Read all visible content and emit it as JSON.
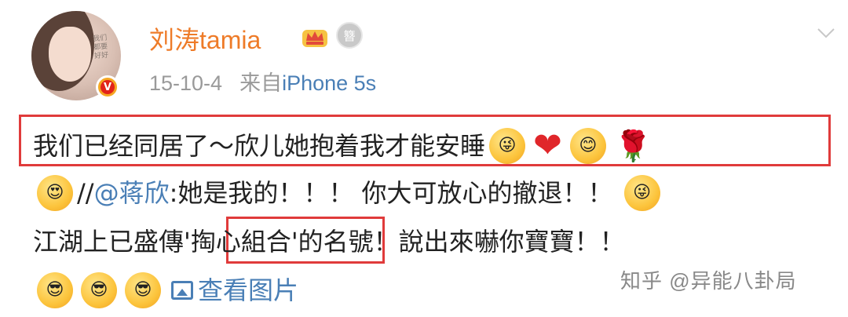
{
  "header": {
    "username": "刘涛tamia",
    "avatar_scribble": "我们都要好好",
    "crown_icon": "crown-icon",
    "medal_text": "簪",
    "date": "15-10-4",
    "source_prefix": "来自",
    "device": "iPhone 5s"
  },
  "post": {
    "line1": "我们已经同居了～欣儿她抱着我才能安睡",
    "line2_prefix": " //",
    "mention": "@蒋欣",
    "line2_rest": ":她是我的！！！ 你大可放心的撤退！！",
    "line3_before": "江湖上已盛傳",
    "line3_box": "'掏心組合'",
    "line3_after": "的名號！說出來嚇你寶寶！！",
    "view_images": "查看图片"
  },
  "watermark": "知乎 @异能八卦局",
  "colors": {
    "username": "#ee7b28",
    "link": "#4a7fb6",
    "highlight_box": "#e03b3b",
    "meta": "#9a9a9a"
  }
}
